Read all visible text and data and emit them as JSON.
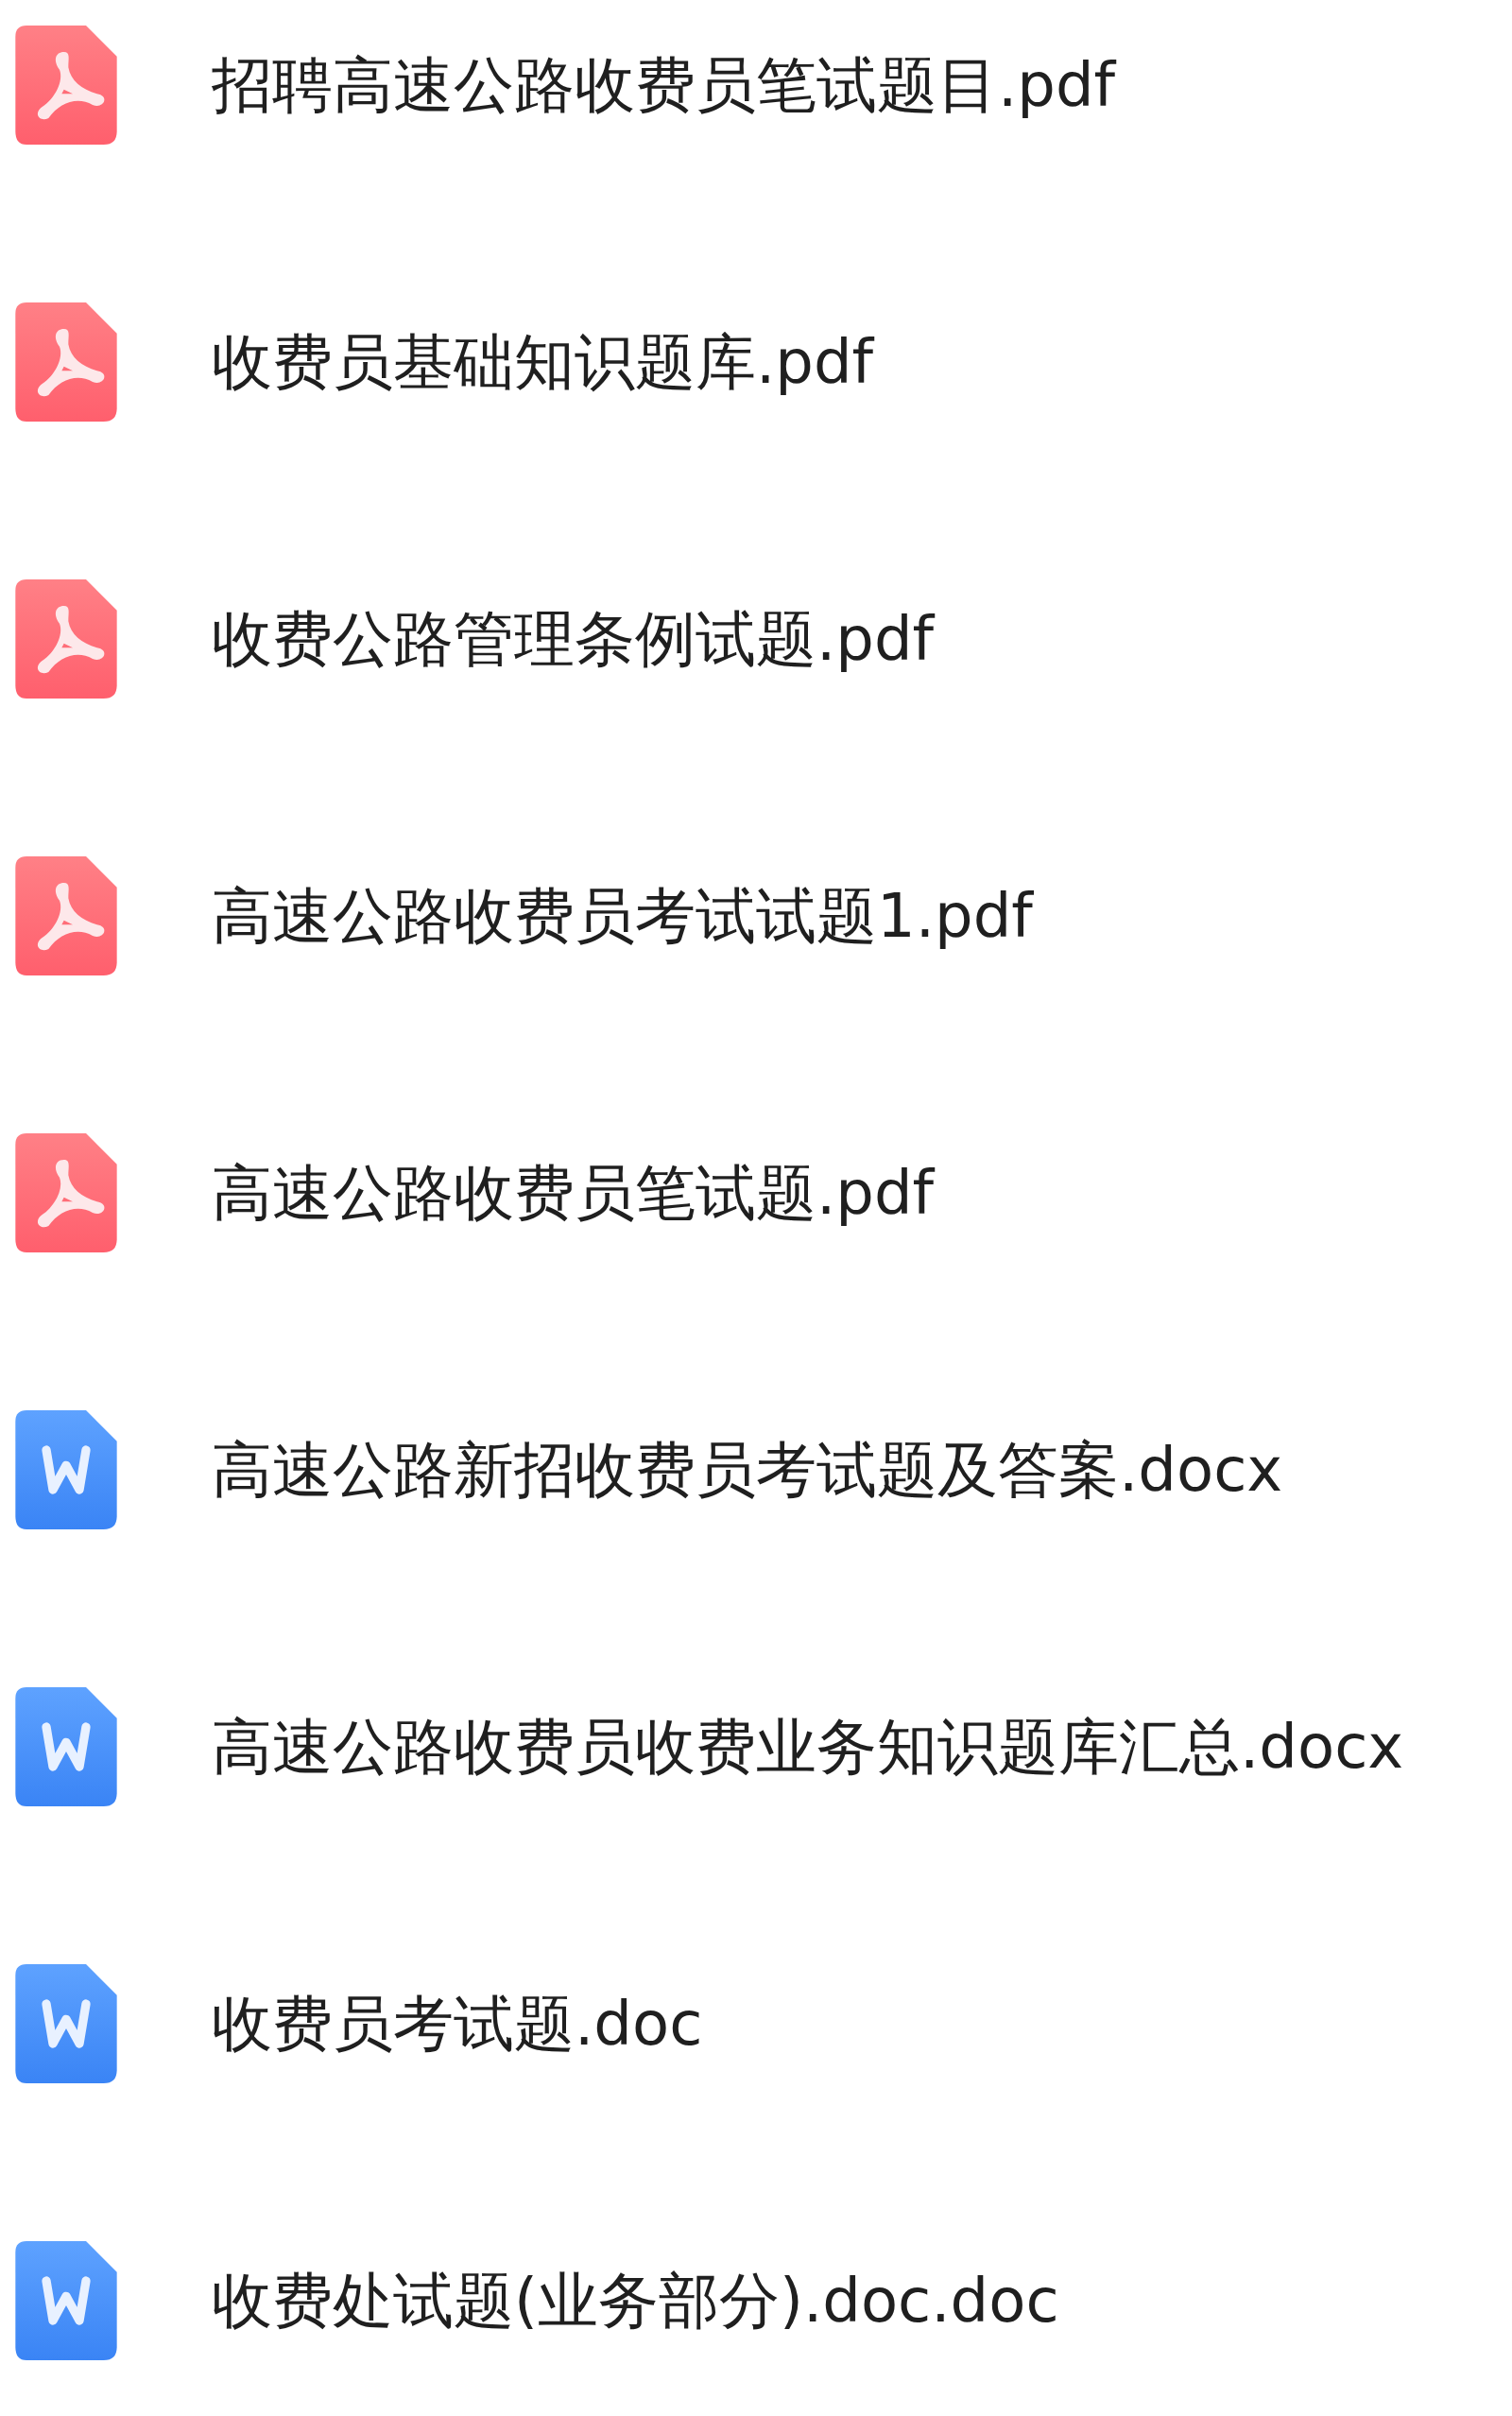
{
  "files": [
    {
      "kind": "pdf",
      "name": "招聘高速公路收费员笔试题目.pdf"
    },
    {
      "kind": "pdf",
      "name": "收费员基础知识题库.pdf"
    },
    {
      "kind": "pdf",
      "name": "收费公路管理条例试题.pdf"
    },
    {
      "kind": "pdf",
      "name": "高速公路收费员考试试题1.pdf"
    },
    {
      "kind": "pdf",
      "name": "高速公路收费员笔试题.pdf"
    },
    {
      "kind": "word",
      "name": "高速公路新招收费员考试题及答案.docx"
    },
    {
      "kind": "word",
      "name": "高速公路收费员收费业务知识题库汇总.docx"
    },
    {
      "kind": "word",
      "name": "收费员考试题.doc"
    },
    {
      "kind": "word",
      "name": "收费处试题(业务部分).doc.doc"
    }
  ]
}
